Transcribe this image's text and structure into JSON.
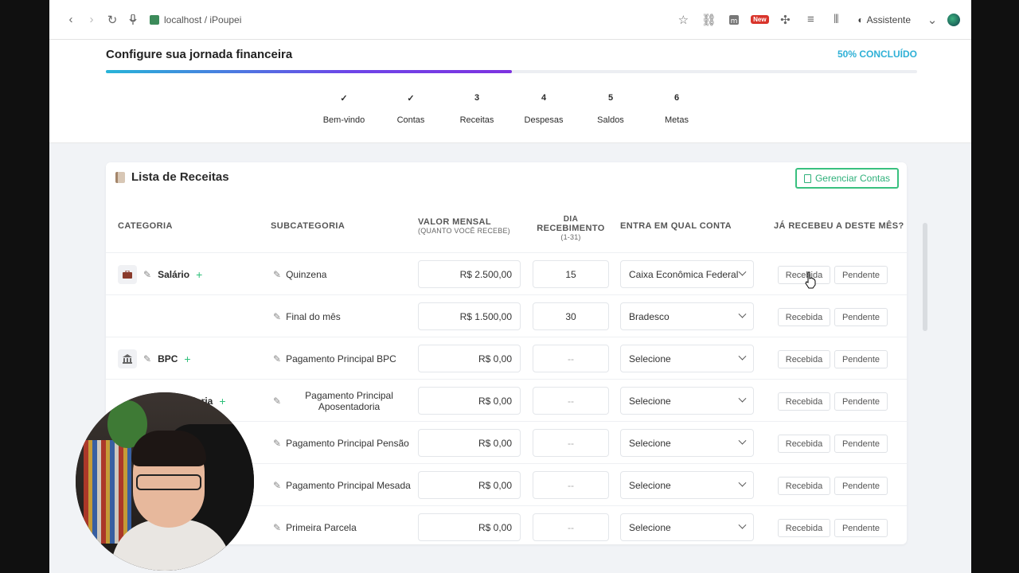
{
  "browser": {
    "url": "localhost / iPoupei",
    "assistant_label": "Assistente",
    "new_badge": "New"
  },
  "progress": {
    "title": "Configure sua jornada financeira",
    "percent_label": "50% CONCLUÍDO",
    "percent": 50,
    "steps": [
      {
        "mark": "✓",
        "label": "Bem-vindo",
        "state": "done"
      },
      {
        "mark": "✓",
        "label": "Contas",
        "state": "done"
      },
      {
        "mark": "3",
        "label": "Receitas",
        "state": "active"
      },
      {
        "mark": "4",
        "label": "Despesas",
        "state": "todo"
      },
      {
        "mark": "5",
        "label": "Saldos",
        "state": "todo"
      },
      {
        "mark": "6",
        "label": "Metas",
        "state": "todo"
      }
    ]
  },
  "card": {
    "title": "Lista de Receitas",
    "manage_button": "Gerenciar Contas"
  },
  "table": {
    "headers": {
      "category": "CATEGORIA",
      "subcategory": "SUBCATEGORIA",
      "monthly_value": "VALOR MENSAL",
      "monthly_value_sub": "(QUANTO VOCÊ RECEBE)",
      "day_line1": "DIA",
      "day_line2": "RECEBIMENTO",
      "day_sub": "(1-31)",
      "account": "ENTRA EM QUAL CONTA",
      "received": "JÁ RECEBEU A DESTE MÊS?"
    },
    "status_received": "Recebida",
    "status_pending": "Pendente",
    "rows": [
      {
        "category": "Salário",
        "category_icon": "briefcase-icon",
        "subcategory": "Quinzena",
        "value": "R$ 2.500,00",
        "day": "15",
        "account": "Caixa Econômica Federal"
      },
      {
        "category": "",
        "subcategory": "Final do mês",
        "value": "R$ 1.500,00",
        "day": "30",
        "account": "Bradesco"
      },
      {
        "category": "BPC",
        "category_icon": "bank-icon",
        "subcategory": "Pagamento Principal BPC",
        "value": "R$ 0,00",
        "day": "--",
        "account": "Selecione"
      },
      {
        "category": "doria",
        "subcategory": "Pagamento Principal Aposentadoria",
        "value": "R$ 0,00",
        "day": "--",
        "account": "Selecione"
      },
      {
        "category": "",
        "subcategory": "Pagamento Principal Pensão",
        "value": "R$ 0,00",
        "day": "--",
        "account": "Selecione"
      },
      {
        "category": "",
        "subcategory": "Pagamento Principal Mesada",
        "value": "R$ 0,00",
        "day": "--",
        "account": "Selecione"
      },
      {
        "category": "",
        "subcategory": "Primeira Parcela",
        "value": "R$ 0,00",
        "day": "--",
        "account": "Selecione"
      }
    ]
  },
  "colors": {
    "accent_green": "#2ec07a",
    "accent_purple": "#7b3fe0",
    "accent_cyan": "#2eb0d6"
  }
}
